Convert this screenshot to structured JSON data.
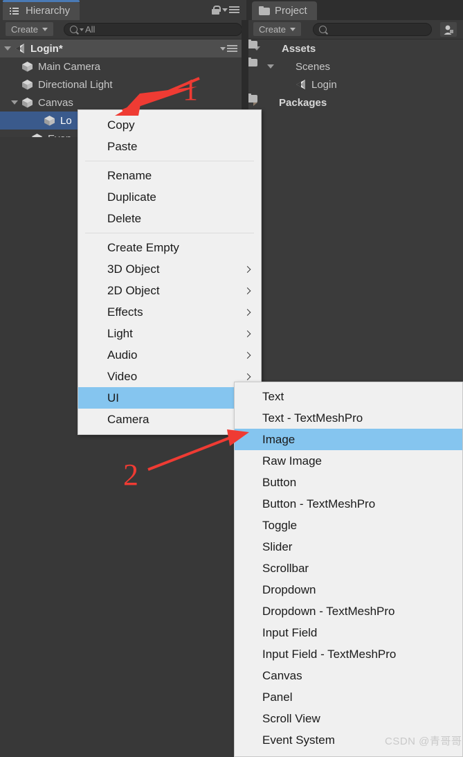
{
  "window": {
    "background_color": "#383838",
    "panel_color": "#3b3b3b",
    "chrome_color": "#393939",
    "selection_color": "#3a5a8c",
    "menu_background": "#f0f0f0",
    "menu_highlight": "#85c5ef",
    "annotation_color": "#ef3b33"
  },
  "hierarchy": {
    "tab_label": "Hierarchy",
    "tab_icon": "hierarchy-list-icon",
    "create_label": "Create",
    "search": {
      "value": "All",
      "placeholder": "All",
      "icon": "search-icon"
    },
    "lock_icon": "lock-icon",
    "menu_icon": "hamburger-menu-icon",
    "scene": {
      "label": "Login*",
      "icon": "unity-logo-icon",
      "expanded": true
    },
    "items": [
      {
        "label": "Main Camera",
        "icon": "cube-icon",
        "depth": 1,
        "twisty": "none",
        "selected": false
      },
      {
        "label": "Directional Light",
        "icon": "cube-icon",
        "depth": 1,
        "twisty": "none",
        "selected": false
      },
      {
        "label": "Canvas",
        "icon": "cube-icon",
        "depth": 1,
        "twisty": "open",
        "selected": false
      },
      {
        "label": "Lo",
        "icon": "cube-icon",
        "depth": 2,
        "twisty": "none",
        "selected": true
      },
      {
        "label": "Even",
        "icon": "cube-icon",
        "depth": 1,
        "twisty": "none",
        "selected": false
      }
    ]
  },
  "project": {
    "tab_label": "Project",
    "tab_icon": "folder-icon",
    "create_label": "Create",
    "search": {
      "value": "",
      "placeholder": "",
      "icon": "search-icon"
    },
    "account_icon": "account-icon",
    "items": [
      {
        "label": "Assets",
        "icon": "folder-icon",
        "depth": 0,
        "twisty": "open",
        "bold": true
      },
      {
        "label": "Scenes",
        "icon": "folder-icon",
        "depth": 1,
        "twisty": "open",
        "bold": false
      },
      {
        "label": "Login",
        "icon": "unity-logo-icon",
        "depth": 2,
        "twisty": "none",
        "bold": false
      },
      {
        "label": "Packages",
        "icon": "folder-icon",
        "depth": 0,
        "twisty": "closed",
        "bold": true
      }
    ]
  },
  "context_menu": {
    "groups": [
      {
        "items": [
          {
            "label": "Copy",
            "submenu": false,
            "highlighted": false
          },
          {
            "label": "Paste",
            "submenu": false,
            "highlighted": false
          }
        ]
      },
      {
        "items": [
          {
            "label": "Rename",
            "submenu": false,
            "highlighted": false
          },
          {
            "label": "Duplicate",
            "submenu": false,
            "highlighted": false
          },
          {
            "label": "Delete",
            "submenu": false,
            "highlighted": false
          }
        ]
      },
      {
        "items": [
          {
            "label": "Create Empty",
            "submenu": false,
            "highlighted": false
          },
          {
            "label": "3D Object",
            "submenu": true,
            "highlighted": false
          },
          {
            "label": "2D Object",
            "submenu": true,
            "highlighted": false
          },
          {
            "label": "Effects",
            "submenu": true,
            "highlighted": false
          },
          {
            "label": "Light",
            "submenu": true,
            "highlighted": false
          },
          {
            "label": "Audio",
            "submenu": true,
            "highlighted": false
          },
          {
            "label": "Video",
            "submenu": true,
            "highlighted": false
          },
          {
            "label": "UI",
            "submenu": true,
            "highlighted": true
          },
          {
            "label": "Camera",
            "submenu": false,
            "highlighted": false
          }
        ]
      }
    ]
  },
  "ui_submenu": {
    "items": [
      {
        "label": "Text",
        "highlighted": false
      },
      {
        "label": "Text - TextMeshPro",
        "highlighted": false
      },
      {
        "label": "Image",
        "highlighted": true
      },
      {
        "label": "Raw Image",
        "highlighted": false
      },
      {
        "label": "Button",
        "highlighted": false
      },
      {
        "label": "Button - TextMeshPro",
        "highlighted": false
      },
      {
        "label": "Toggle",
        "highlighted": false
      },
      {
        "label": "Slider",
        "highlighted": false
      },
      {
        "label": "Scrollbar",
        "highlighted": false
      },
      {
        "label": "Dropdown",
        "highlighted": false
      },
      {
        "label": "Dropdown - TextMeshPro",
        "highlighted": false
      },
      {
        "label": "Input Field",
        "highlighted": false
      },
      {
        "label": "Input Field - TextMeshPro",
        "highlighted": false
      },
      {
        "label": "Canvas",
        "highlighted": false
      },
      {
        "label": "Panel",
        "highlighted": false
      },
      {
        "label": "Scroll View",
        "highlighted": false
      },
      {
        "label": "Event System",
        "highlighted": false
      }
    ]
  },
  "annotations": {
    "step_one": "1",
    "step_two": "2"
  },
  "watermark": {
    "text": "CSDN @青哥哥"
  }
}
